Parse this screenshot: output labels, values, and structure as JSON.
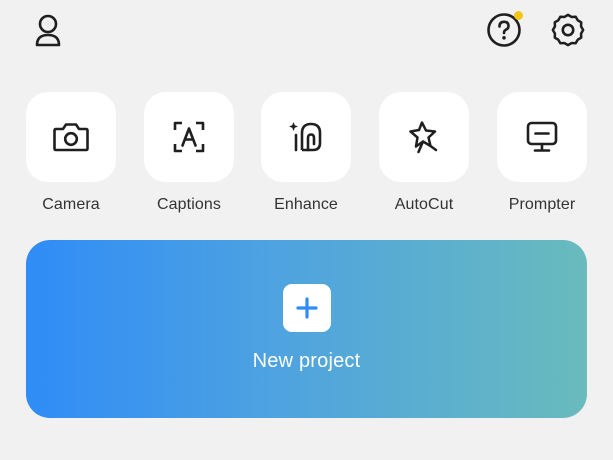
{
  "colors": {
    "background": "#f1f1f2",
    "icon": "#1f1f1f",
    "badge": "#f5c518",
    "gradient_start": "#2f8cf7",
    "gradient_end": "#69bbbd"
  },
  "header": {
    "profile_icon": "person-icon",
    "help_icon": "help-circle-icon",
    "help_has_badge": true,
    "settings_icon": "gear-icon"
  },
  "tools": [
    {
      "label": "Camera",
      "icon": "camera-icon"
    },
    {
      "label": "Captions",
      "icon": "captions-icon"
    },
    {
      "label": "Enhance",
      "icon": "enhance-icon"
    },
    {
      "label": "AutoCut",
      "icon": "autocut-star-icon"
    },
    {
      "label": "Prompter",
      "icon": "prompter-icon"
    }
  ],
  "new_project": {
    "label": "New project",
    "icon": "plus-icon"
  }
}
